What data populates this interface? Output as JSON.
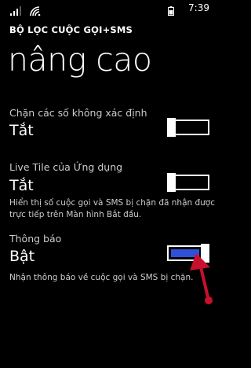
{
  "status_bar": {
    "time": "7:39",
    "icons": [
      "signal-icon",
      "wifi-icon",
      "battery-icon"
    ]
  },
  "app": {
    "title": "BỘ LỌC CUỘC GỌI+SMS"
  },
  "page": {
    "title": "nâng cao"
  },
  "settings": [
    {
      "label": "Chặn các số không xác định",
      "value": "Tắt",
      "on": false,
      "description": ""
    },
    {
      "label": "Live Tile của Ứng dụng",
      "value": "Tắt",
      "on": false,
      "description": "Hiển thị số cuộc gọi và SMS bị chặn đã nhận được trực tiếp trên Màn hình Bắt đầu."
    },
    {
      "label": "Thông báo",
      "value": "Bật",
      "on": true,
      "description": "Nhận thông báo về cuộc gọi và SMS bị chặn."
    }
  ],
  "colors": {
    "background": "#000000",
    "text": "#ffffff",
    "secondary_text": "#cccccc",
    "accent": "#2f51d9",
    "annotation": "#c8102e"
  }
}
